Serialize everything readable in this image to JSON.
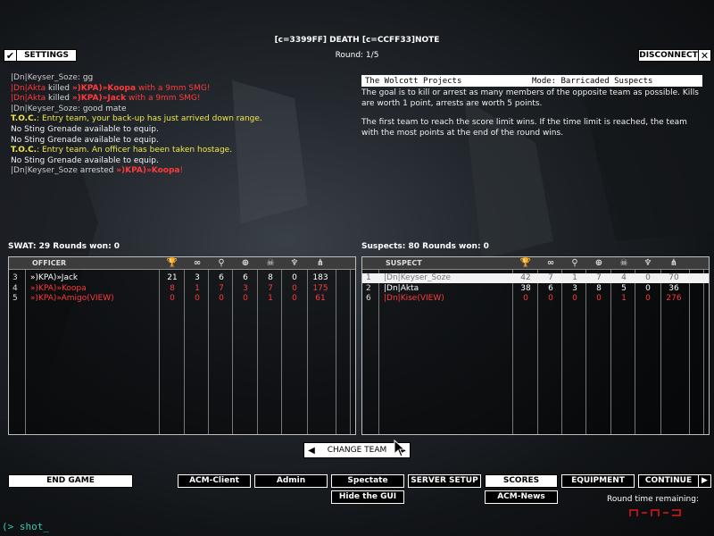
{
  "header": {
    "title": "[c=3399FF] DEATH [c=CCFF33]NOTE",
    "round": "Round: 1/5",
    "settings_label": "SETTINGS",
    "disconnect_label": "DISCONNECT"
  },
  "chat": [
    {
      "parts": [
        {
          "t": "|Dn|Keyser_Soze",
          "c": "gray",
          "b": false
        },
        {
          "t": ": gg",
          "c": "lt",
          "b": false
        }
      ]
    },
    {
      "parts": [
        {
          "t": "|Dn|Akta",
          "c": "red",
          "b": false
        },
        {
          "t": " killed ",
          "c": "lt",
          "b": false
        },
        {
          "t": "»)KPA)»Koopa",
          "c": "red",
          "b": true
        },
        {
          "t": " with a 9mm SMG!",
          "c": "red",
          "b": false
        }
      ]
    },
    {
      "parts": [
        {
          "t": "|Dn|Akta",
          "c": "red",
          "b": false
        },
        {
          "t": " killed ",
          "c": "lt",
          "b": false
        },
        {
          "t": "»)KPA)»Jack",
          "c": "red",
          "b": true
        },
        {
          "t": " with a 9mm SMG!",
          "c": "red",
          "b": false
        }
      ]
    },
    {
      "parts": [
        {
          "t": "|Dn|Keyser_Soze",
          "c": "gray",
          "b": false
        },
        {
          "t": ": good mate",
          "c": "lt",
          "b": false
        }
      ]
    },
    {
      "parts": [
        {
          "t": "T.O.C.",
          "c": "yellow",
          "b": true
        },
        {
          "t": ": Entry team, your back-up has just arrived down range.",
          "c": "yellow",
          "b": false
        }
      ]
    },
    {
      "parts": [
        {
          "t": "No Sting Grenade available to equip.",
          "c": "white",
          "b": false
        }
      ]
    },
    {
      "parts": [
        {
          "t": "No Sting Grenade available to equip.",
          "c": "white",
          "b": false
        }
      ]
    },
    {
      "parts": [
        {
          "t": "T.O.C.",
          "c": "yellow",
          "b": true
        },
        {
          "t": ": Entry team.  An officer has been taken hostage.",
          "c": "yellow",
          "b": false
        }
      ]
    },
    {
      "parts": [
        {
          "t": "No Sting Grenade available to equip.",
          "c": "white",
          "b": false
        }
      ]
    },
    {
      "parts": [
        {
          "t": "|Dn|Keyser_Soze",
          "c": "gray",
          "b": false
        },
        {
          "t": " arrested ",
          "c": "lt",
          "b": false
        },
        {
          "t": "»)KPA)»Koopa",
          "c": "red",
          "b": true
        },
        {
          "t": "!",
          "c": "red",
          "b": false
        }
      ]
    }
  ],
  "info": {
    "map": "The Wolcott Projects",
    "mode": "Mode: Barricaded Suspects",
    "para1": "The goal is to kill or arrest as many members of the opposite team as possible.  Kills are worth 1 point, arrests are worth 5 points.",
    "para2": "The first team to reach the score limit wins.  If the time limit is reached, the team with the most points at the end of the round wins."
  },
  "swat": {
    "label": "SWAT: 29    Rounds won: 0",
    "column": "OFFICER",
    "rows": [
      {
        "n": "3",
        "name": "»)KPA)»Jack",
        "color": "#ffffff",
        "vals": [
          "21",
          "3",
          "6",
          "6",
          "8",
          "0",
          "183"
        ]
      },
      {
        "n": "4",
        "name": "»)KPA)»Koopa",
        "color": "#ff3a3a",
        "vals": [
          "8",
          "1",
          "7",
          "3",
          "7",
          "0",
          "175"
        ]
      },
      {
        "n": "5",
        "name": "»)KPA)»Amigo(VIEW)",
        "color": "#ff3a3a",
        "vals": [
          "0",
          "0",
          "0",
          "0",
          "1",
          "0",
          "61"
        ]
      }
    ]
  },
  "suspects": {
    "label": "Suspects: 80    Rounds won: 0",
    "column": "SUSPECT",
    "rows": [
      {
        "n": "1",
        "name": "|Dn|Keyser_Soze",
        "color": "#777777",
        "vals": [
          "42",
          "7",
          "1",
          "7",
          "4",
          "0",
          "70"
        ],
        "selected": true
      },
      {
        "n": "2",
        "name": "|Dn|Akta",
        "color": "#ffffff",
        "vals": [
          "38",
          "6",
          "3",
          "8",
          "5",
          "0",
          "36"
        ]
      },
      {
        "n": "6",
        "name": "|Dn|Kise(VIEW)",
        "color": "#ff3a3a",
        "vals": [
          "0",
          "0",
          "0",
          "0",
          "1",
          "0",
          "276"
        ]
      }
    ]
  },
  "icons": [
    "trophy-icon",
    "handcuffs-icon",
    "microscope-icon",
    "crosshair-icon",
    "skull-icon",
    "medal-icon",
    "network-icon"
  ],
  "buttons": {
    "change_team": "CHANGE TEAM",
    "end_game": "END GAME",
    "acm_client": "ACM-Client",
    "admin": "Admin",
    "spectate": "Spectate",
    "hide_gui": "Hide the GUI",
    "server_setup": "SERVER SETUP",
    "scores": "SCORES",
    "acm_news": "ACM-News",
    "equipment": "EQUIPMENT",
    "continue": "CONTINUE"
  },
  "round_time_label": "Round time remaining:",
  "round_time_value": "",
  "console": "(> shot_"
}
